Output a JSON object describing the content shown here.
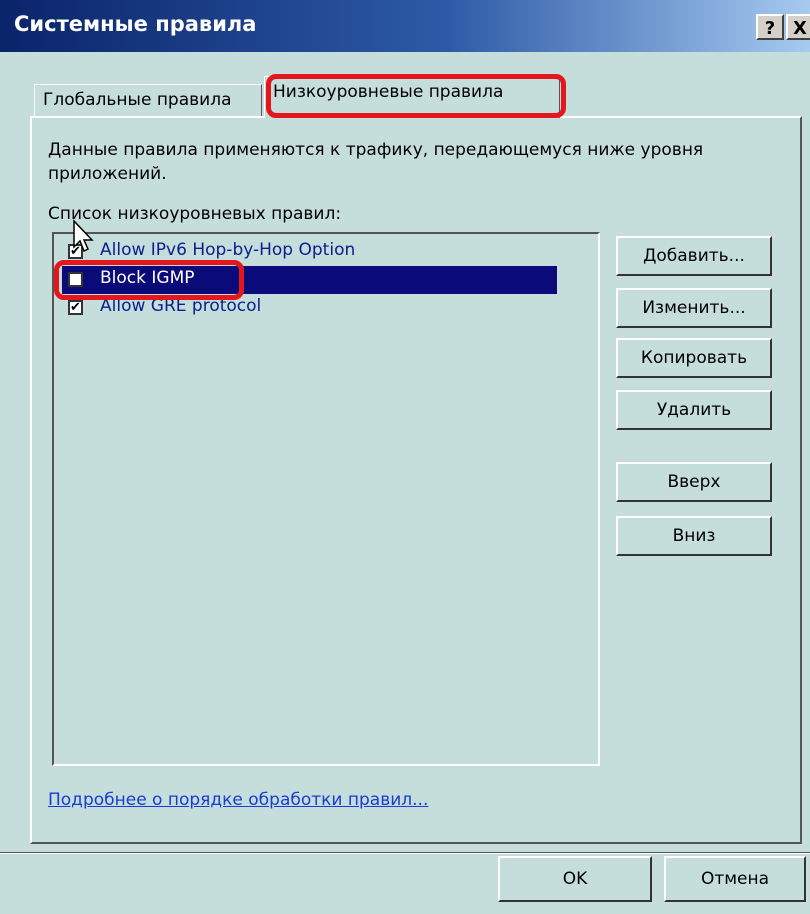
{
  "window": {
    "title": "Системные правила",
    "help_button": "?",
    "close_button": "X"
  },
  "tabs": [
    {
      "label": "Глобальные правила",
      "active": false
    },
    {
      "label": "Низкоуровневые правила",
      "active": true
    }
  ],
  "description": "Данные правила применяются к трафику, передающемуся ниже уровня приложений.",
  "list": {
    "label": "Список низкоуровневых правил:",
    "items": [
      {
        "label": "Allow IPv6 Hop-by-Hop Option",
        "checked": true,
        "selected": false
      },
      {
        "label": "Block IGMP",
        "checked": false,
        "selected": true
      },
      {
        "label": "Allow GRE protocol",
        "checked": true,
        "selected": false
      }
    ]
  },
  "side_buttons": {
    "add": "Добавить...",
    "edit": "Изменить...",
    "copy": "Копировать",
    "delete": "Удалить",
    "up": "Вверх",
    "down": "Вниз"
  },
  "link": "Подробнее о порядке обработки правил...",
  "footer": {
    "ok": "OK",
    "cancel": "Отмена"
  },
  "colors": {
    "highlight_frame": "#e5161d",
    "selection": "#0a0a78",
    "title_bar": "#0a246a"
  }
}
